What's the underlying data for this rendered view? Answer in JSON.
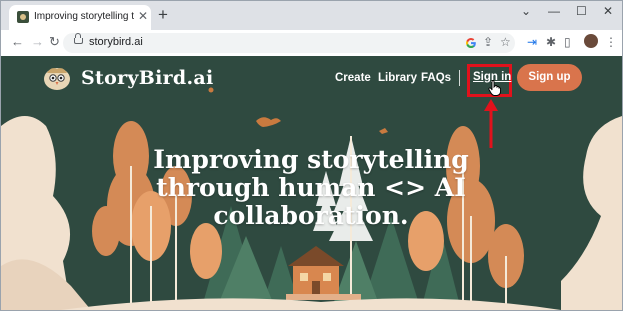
{
  "browser": {
    "tab_title": "Improving storytelling through h",
    "tab_close": "✕",
    "new_tab": "+",
    "window_minimize": "⌄",
    "window_min": "—",
    "window_restore": "☐",
    "window_close": "✕",
    "back": "←",
    "forward": "→",
    "reload": "↻",
    "url": "storybird.ai",
    "icons": [
      "google-icon",
      "share-icon",
      "bookmark-star-icon",
      "extension-import-icon",
      "puzzle-icon",
      "sidebar-icon",
      "profile-avatar",
      "menu-kebab-icon"
    ]
  },
  "site": {
    "brand": "StoryBird.ai",
    "nav": {
      "create": "Create",
      "library": "Library",
      "faqs": "FAQs",
      "sign_in": "Sign in",
      "sign_up": "Sign up"
    },
    "hero_line1": "Improving storytelling",
    "hero_line2": "through human <> AI",
    "hero_line3": "collaboration."
  },
  "colors": {
    "page_bg": "#2f4a40",
    "signup_button": "#d9744c",
    "highlight_box": "#e1121c",
    "arrow": "#e1121c"
  }
}
